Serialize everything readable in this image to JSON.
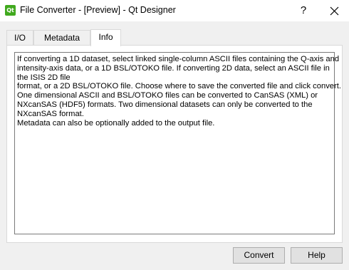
{
  "window": {
    "icon_label": "Qt",
    "title": "File Converter - [Preview] - Qt Designer",
    "help_glyph": "?"
  },
  "tabs": [
    {
      "label": "I/O"
    },
    {
      "label": "Metadata"
    },
    {
      "label": "Info"
    }
  ],
  "info": {
    "lines": [
      "If converting a 1D dataset, select linked single-column ASCII files containing the Q-axis and",
      "intensity-axis data, or a 1D BSL/OTOKO file. If converting 2D data, select an ASCII file in",
      "the ISIS 2D file",
      "format, or a 2D BSL/OTOKO file. Choose where to save the converted file and click convert.",
      "One dimensional ASCII and BSL/OTOKO files can be converted to CanSAS (XML) or",
      "NXcanSAS (HDF5) formats. Two dimensional datasets can only be converted to the",
      "NXcanSAS format.",
      "Metadata can also be optionally added to the output file."
    ]
  },
  "buttons": {
    "convert": "Convert",
    "help": "Help"
  }
}
